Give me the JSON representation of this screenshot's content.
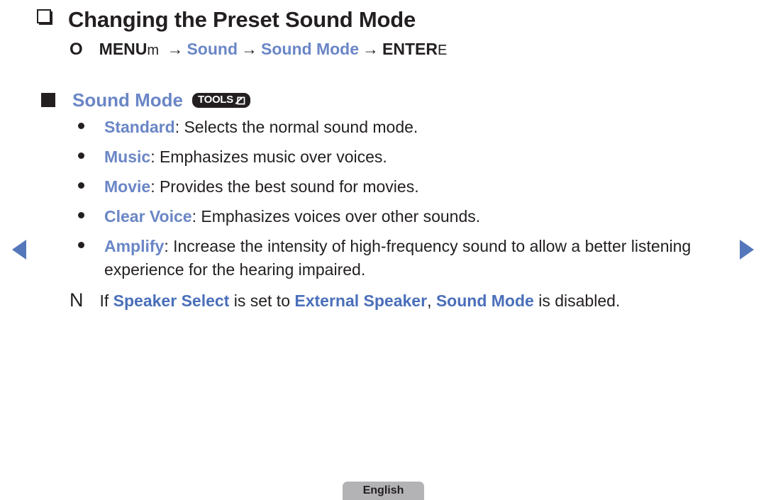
{
  "page": {
    "title": "Changing the Preset Sound Mode",
    "title_marker_icon": "outlined-square-marker",
    "section_marker_icon": "filled-square-marker"
  },
  "menu_path": {
    "bullet_glyph": "O",
    "parts": [
      {
        "text": "MENU",
        "style": "bold"
      },
      {
        "text": "m",
        "style": "remote-key"
      },
      {
        "text": "→",
        "style": "arrow"
      },
      {
        "text": "Sound",
        "style": "blue"
      },
      {
        "text": "→",
        "style": "arrow"
      },
      {
        "text": "Sound Mode",
        "style": "blue"
      },
      {
        "text": "→",
        "style": "arrow"
      },
      {
        "text": "ENTER",
        "style": "bold"
      },
      {
        "text": "E",
        "style": "remote-key"
      }
    ]
  },
  "section": {
    "heading": "Sound Mode",
    "badge": {
      "label": "TOOLS",
      "icon": "tools-arrow-box-icon"
    }
  },
  "options": [
    {
      "term": "Standard",
      "description": ": Selects the normal sound mode."
    },
    {
      "term": "Music",
      "description": ": Emphasizes music over voices."
    },
    {
      "term": "Movie",
      "description": ": Provides the best sound for movies."
    },
    {
      "term": "Clear Voice",
      "description": ": Emphasizes voices over other sounds."
    },
    {
      "term": "Amplify",
      "description": ": Increase the intensity of high-frequency sound to allow a better listening experience for the hearing impaired."
    }
  ],
  "note": {
    "glyph": "N",
    "segments": [
      {
        "text": "If ",
        "style": "plain"
      },
      {
        "text": "Speaker Select",
        "style": "blue"
      },
      {
        "text": " is set to ",
        "style": "plain"
      },
      {
        "text": "External Speaker",
        "style": "blue"
      },
      {
        "text": ", ",
        "style": "plain"
      },
      {
        "text": "Sound Mode",
        "style": "blue"
      },
      {
        "text": " is disabled.",
        "style": "plain"
      }
    ]
  },
  "footer": {
    "language": "English"
  },
  "navigation": {
    "prev_icon": "triangle-left-icon",
    "next_icon": "triangle-right-icon"
  },
  "colors": {
    "accent_blue": "#6a86c6",
    "note_blue": "#4a6fba",
    "arrow_blue": "#5477bb",
    "text_black": "#231f20",
    "badge_gray": "#b3b3b6"
  }
}
